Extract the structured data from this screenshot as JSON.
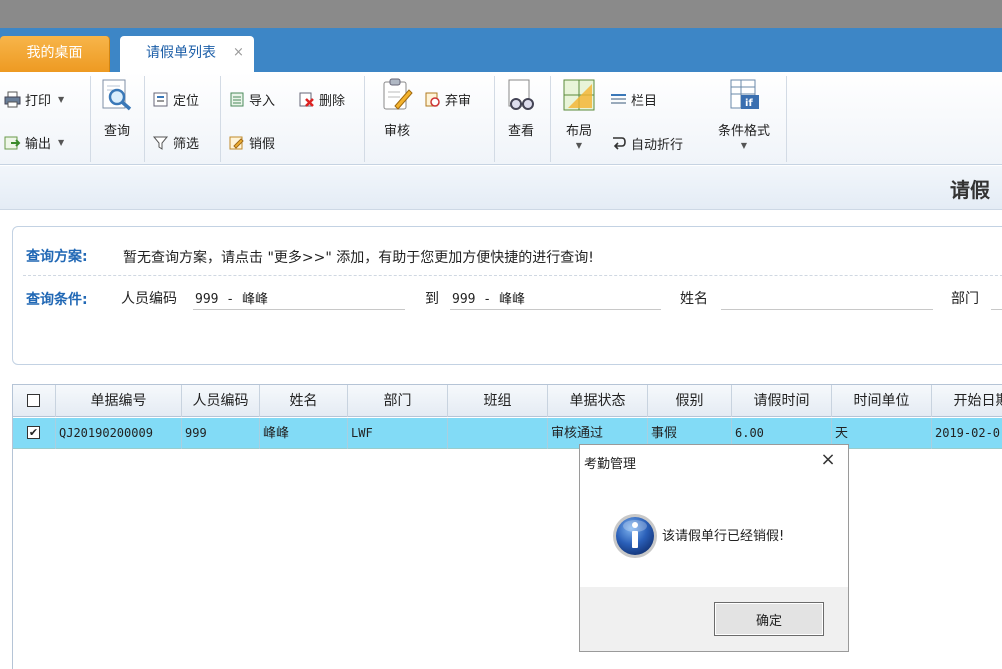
{
  "tabs": [
    {
      "label": "我的桌面",
      "active": false
    },
    {
      "label": "请假单列表",
      "active": true,
      "close": "×"
    }
  ],
  "ribbon": {
    "print": "打印",
    "export": "输出",
    "query": "查询",
    "locate": "定位",
    "filter": "筛选",
    "import": "导入",
    "delete": "删除",
    "cancel_leave": "销假",
    "review": "审核",
    "abandon_review": "弃审",
    "view": "查看",
    "layout": "布局",
    "columns": "栏目",
    "auto_wrap": "自动折行",
    "conditional_format": "条件格式"
  },
  "page_title": "请假",
  "query": {
    "plan_label": "查询方案:",
    "plan_text": "暂无查询方案，请点击 \"更多>>\" 添加，有助于您更加方便快捷的进行查询!",
    "cond_label": "查询条件:",
    "emp_code_label": "人员编码",
    "emp_code_from": "999 - 峰峰",
    "to_label": "到",
    "emp_code_to": "999 - 峰峰",
    "name_label": "姓名",
    "name_value": "",
    "dept_label": "部门"
  },
  "grid": {
    "columns": [
      "单据编号",
      "人员编码",
      "姓名",
      "部门",
      "班组",
      "单据状态",
      "假别",
      "请假时间",
      "时间单位",
      "开始日期"
    ],
    "rows": [
      {
        "checked": true,
        "doc_no": "QJ20190200009",
        "emp_code": "999",
        "name": "峰峰",
        "dept": "LWF",
        "team": "",
        "status": "审核通过",
        "leave_type": "事假",
        "leave_time": "6.00",
        "time_unit": "天",
        "start_date": "2019-02-0"
      }
    ]
  },
  "dialog": {
    "title": "考勤管理",
    "close": "×",
    "message": "该请假单行已经销假!",
    "ok": "确定"
  },
  "colors": {
    "tab_bar": "#3d86c6",
    "tab_desktop": "#f0a030",
    "selected_row": "#82dbf6",
    "label_blue": "#2168b5"
  }
}
